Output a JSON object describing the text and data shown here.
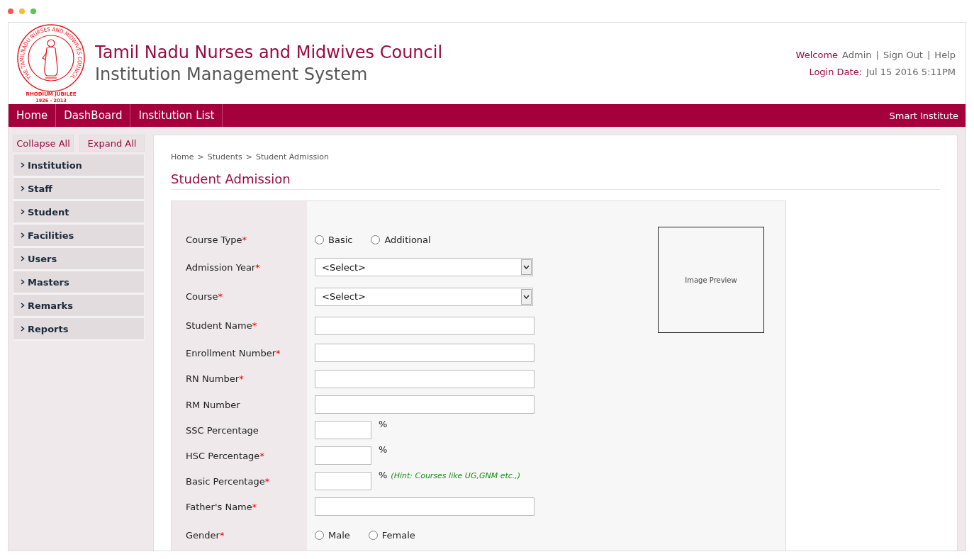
{
  "logo": {
    "ring_text": "THE TAMILNADU NURSES AND MIDWIVES COUNCIL",
    "banner": "RHODIUM JUBILEE",
    "years": "1926 - 2013"
  },
  "header": {
    "title": "Tamil Nadu Nurses and Midwives Council",
    "subtitle": "Institution Management System",
    "welcome_label": "Welcome",
    "user": "Admin",
    "links": [
      "Sign Out",
      "Help"
    ],
    "link_separator": "|",
    "login_label": "Login Date:",
    "login_date": "Jul 15 2016 5:11PM"
  },
  "nav": {
    "items": [
      "Home",
      "DashBoard",
      "Institution List"
    ],
    "right": "Smart Institute"
  },
  "sidebar": {
    "buttons": [
      "Collapse All",
      "Expand All"
    ],
    "items": [
      {
        "label": "Institution",
        "expanded": false
      },
      {
        "label": "Staff",
        "expanded": false
      },
      {
        "label": "Student",
        "expanded": false
      },
      {
        "label": "Facilities",
        "expanded": false
      },
      {
        "label": "Users",
        "expanded": false
      },
      {
        "label": "Masters",
        "expanded": false
      },
      {
        "label": "Remarks",
        "expanded": false
      },
      {
        "label": "Reports",
        "expanded": false
      }
    ]
  },
  "breadcrumb": [
    "Home",
    "Students",
    "Student Admission"
  ],
  "breadcrumb_separator": ">",
  "page_title": "Student Admission",
  "image_preview": "Image Preview",
  "form": [
    {
      "kind": "radio",
      "label": "Course Type",
      "required": "*",
      "options": [
        {
          "label": "Basic",
          "selected": false
        },
        {
          "label": "Additional",
          "selected": false
        }
      ]
    },
    {
      "kind": "select",
      "label": "Admission Year",
      "required": "*",
      "value": "<Select>"
    },
    {
      "kind": "select",
      "label": "Course",
      "required": "*",
      "value": "<Select>"
    },
    {
      "kind": "text",
      "label": "Student Name",
      "required": "*"
    },
    {
      "kind": "text",
      "label": "Enrollment Number",
      "required": "*"
    },
    {
      "kind": "text",
      "label": "RN Number",
      "required": "*"
    },
    {
      "kind": "text",
      "label": "RM Number"
    },
    {
      "kind": "percent",
      "label": "SSC Percentage",
      "unit": "%"
    },
    {
      "kind": "percent",
      "label": "HSC Percentage",
      "required": "*",
      "unit": "%"
    },
    {
      "kind": "percent",
      "label": "Basic Percentage",
      "required": "*",
      "unit": "%",
      "hint": "(Hint: Courses like UG,GNM etc.,)"
    },
    {
      "kind": "text",
      "label": "Father's Name",
      "required": "*"
    },
    {
      "kind": "radio",
      "label": "Gender",
      "required": "*",
      "options": [
        {
          "label": "Male",
          "selected": false
        },
        {
          "label": "Female",
          "selected": false
        }
      ]
    }
  ]
}
